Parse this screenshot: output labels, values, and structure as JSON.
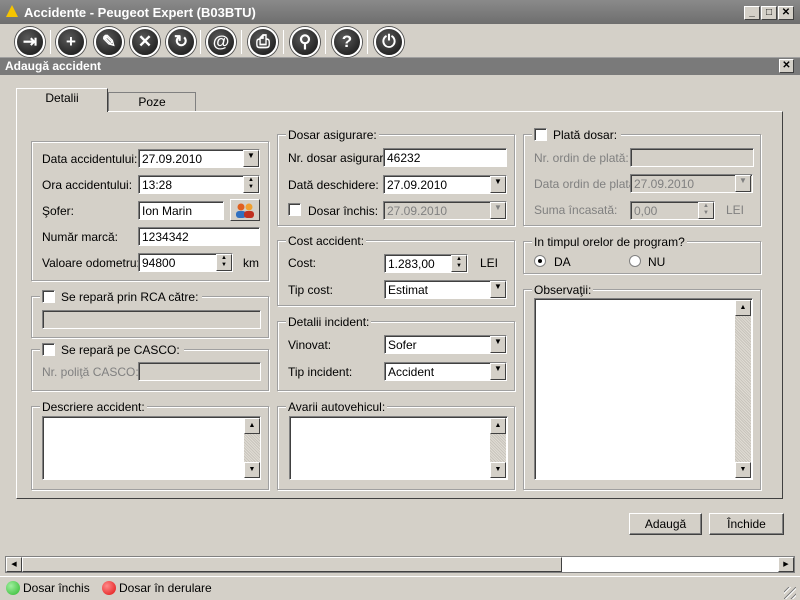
{
  "window": {
    "title": "Accidente - Peugeot Expert (B03BTU)"
  },
  "toolbar": {
    "buttons": [
      "exit-icon",
      "plus-icon",
      "pencil-icon",
      "delete-icon",
      "refresh-icon",
      "email-icon",
      "print-icon",
      "search-icon",
      "help-icon",
      "power-icon"
    ]
  },
  "dialog": {
    "title": "Adaugă accident"
  },
  "tabs": [
    "Detalii",
    "Poze"
  ],
  "accident": {
    "date_label": "Data accidentului:",
    "date": "27.09.2010",
    "time_label": "Ora accidentului:",
    "time": "13:28",
    "driver_label": "Şofer:",
    "driver": "Ion Marin",
    "plate_label": "Număr marcă:",
    "plate": "1234342",
    "odometer_label": "Valoare odometru:",
    "odometer": "94800",
    "odometer_unit": "km"
  },
  "rca": {
    "label": "Se repară prin RCA către:",
    "value": ""
  },
  "casco": {
    "label": "Se repară pe CASCO:",
    "policy_label": "Nr. poliţă CASCO:",
    "policy": ""
  },
  "description": {
    "label": "Descriere accident:",
    "value": ""
  },
  "insurance": {
    "group_label": "Dosar asigurare:",
    "number_label": "Nr. dosar asigurare:",
    "number": "46232",
    "open_label": "Dată deschidere:",
    "open_date": "27.09.2010",
    "closed_label": "Dosar închis:",
    "closed_date": "27.09.2010"
  },
  "cost": {
    "group_label": "Cost accident:",
    "cost_label": "Cost:",
    "cost": "1.283,00",
    "currency": "LEI",
    "type_label": "Tip cost:",
    "type": "Estimat"
  },
  "incident": {
    "group_label": "Detalii incident:",
    "guilty_label": "Vinovat:",
    "guilty": "Sofer",
    "type_label": "Tip incident:",
    "type": "Accident"
  },
  "damage": {
    "label": "Avarii autovehicul:",
    "value": ""
  },
  "payment": {
    "group_label": "Plată dosar:",
    "order_no_label": "Nr. ordin de plată:",
    "order_no": "",
    "order_date_label": "Data ordin de plată:",
    "order_date": "27.09.2010",
    "amount_label": "Suma încasată:",
    "amount": "0,00",
    "currency": "LEI"
  },
  "program": {
    "group_label": "In timpul orelor de program?",
    "yes": "DA",
    "no": "NU",
    "selected": "DA"
  },
  "notes": {
    "label": "Observaţii:",
    "value": ""
  },
  "actions": {
    "add": "Adaugă",
    "close": "Închide"
  },
  "legend": {
    "closed": "Dosar închis",
    "closed_color": "#2db82d",
    "open": "Dosar în derulare",
    "open_color": "#e01010"
  }
}
